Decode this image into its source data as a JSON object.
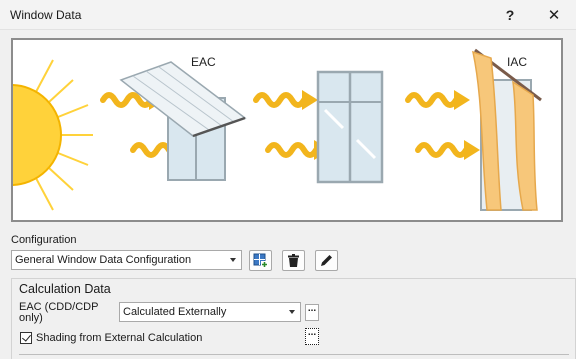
{
  "window": {
    "title": "Window Data",
    "help_label": "?",
    "close_label": "✕"
  },
  "illustration": {
    "eac_label": "EAC",
    "iac_label": "IAC"
  },
  "configuration": {
    "label": "Configuration",
    "selected": "General Window Data Configuration",
    "buttons": [
      "add-config-icon",
      "delete-config-icon",
      "edit-config-icon"
    ]
  },
  "calculation": {
    "title": "Calculation Data",
    "eac_label_line1": "EAC (CDD/CDP",
    "eac_label_line2": "only)",
    "eac_selected": "Calculated Externally",
    "dots_label": "...",
    "shading_label": "Shading from External Calculation",
    "shading_checked": true
  },
  "colors": {
    "sun": "#ffd23a",
    "arrow": "#f2b51d",
    "curtain": "#f7c77a",
    "window_frame": "#cfe0ea"
  }
}
